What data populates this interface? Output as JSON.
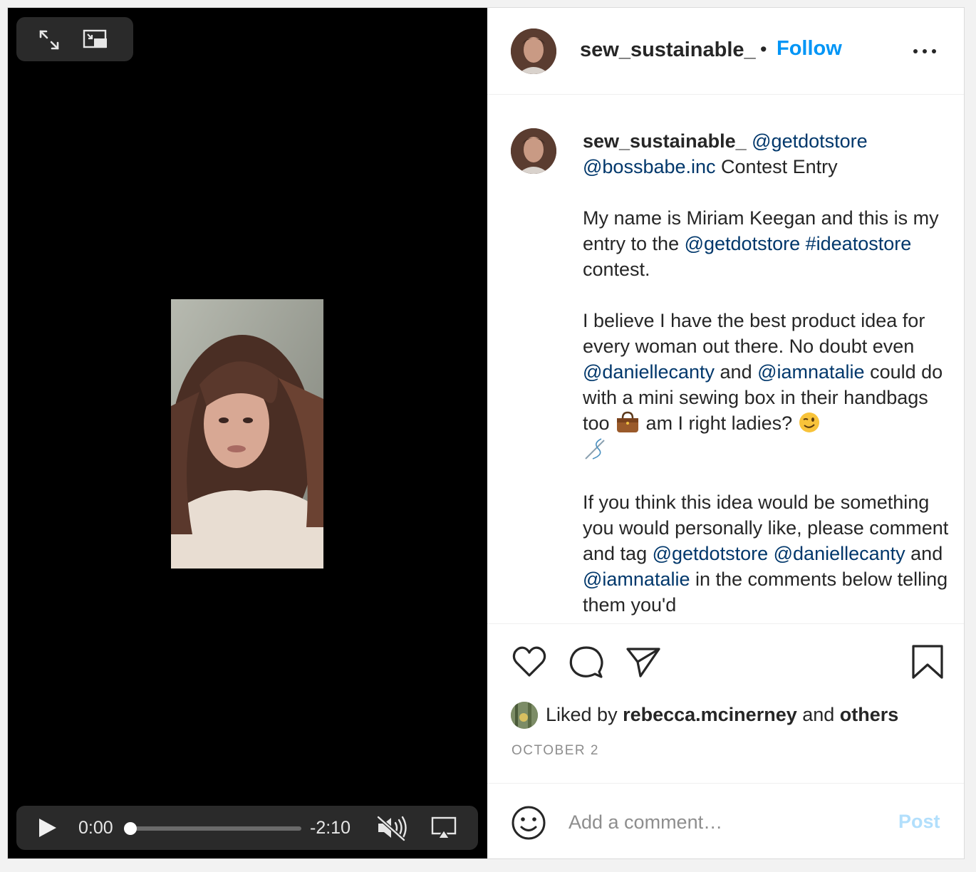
{
  "video": {
    "current_time": "0:00",
    "remaining_time": "-2:10",
    "progress": 0.0,
    "icons": [
      "expand-icon",
      "picture-in-picture-icon",
      "play-icon",
      "mute-icon",
      "airplay-icon"
    ]
  },
  "post": {
    "author": "sew_sustainable_",
    "header_separator": "•",
    "follow_label": "Follow",
    "caption": {
      "author": "sew_sustainable_",
      "line1_mention": "@getdotstore",
      "line2_mention": "@bossbabe.inc",
      "line2_text": " Contest Entry",
      "p2_text": "My name is Miriam Keegan and this is my entry to the ",
      "p2_mention": "@getdotstore",
      "p2_hashtag": "#ideatostore",
      "p2_tail": " contest.",
      "p3_text": "I believe I have the best product idea for every woman out there. No doubt even ",
      "p3_mention1": "@daniellecanty",
      "p3_and": " and ",
      "p3_mention2": "@iamnatalie",
      "p3_tail": " could do with a mini sewing box in their handbags too ",
      "p3_tail2": " am I right ladies? ",
      "p4_text": "If you think this idea would be something you would personally like, please comment and tag ",
      "p4_mention1": "@getdotstore",
      "p4_mention2": "@daniellecanty",
      "p4_and": " and ",
      "p4_mention3": "@iamnatalie",
      "p4_tail": " in the comments below telling them you'd"
    },
    "likes": {
      "prefix": "Liked by ",
      "user": "rebecca.mcinerney",
      "and": " and ",
      "others": "others"
    },
    "date": "OCTOBER 2",
    "comment": {
      "placeholder": "Add a comment…",
      "post_label": "Post"
    }
  },
  "colors": {
    "link": "#0095f6",
    "mention": "#00376b",
    "post_disabled": "#b2dffc",
    "video_bg": "#000000"
  }
}
